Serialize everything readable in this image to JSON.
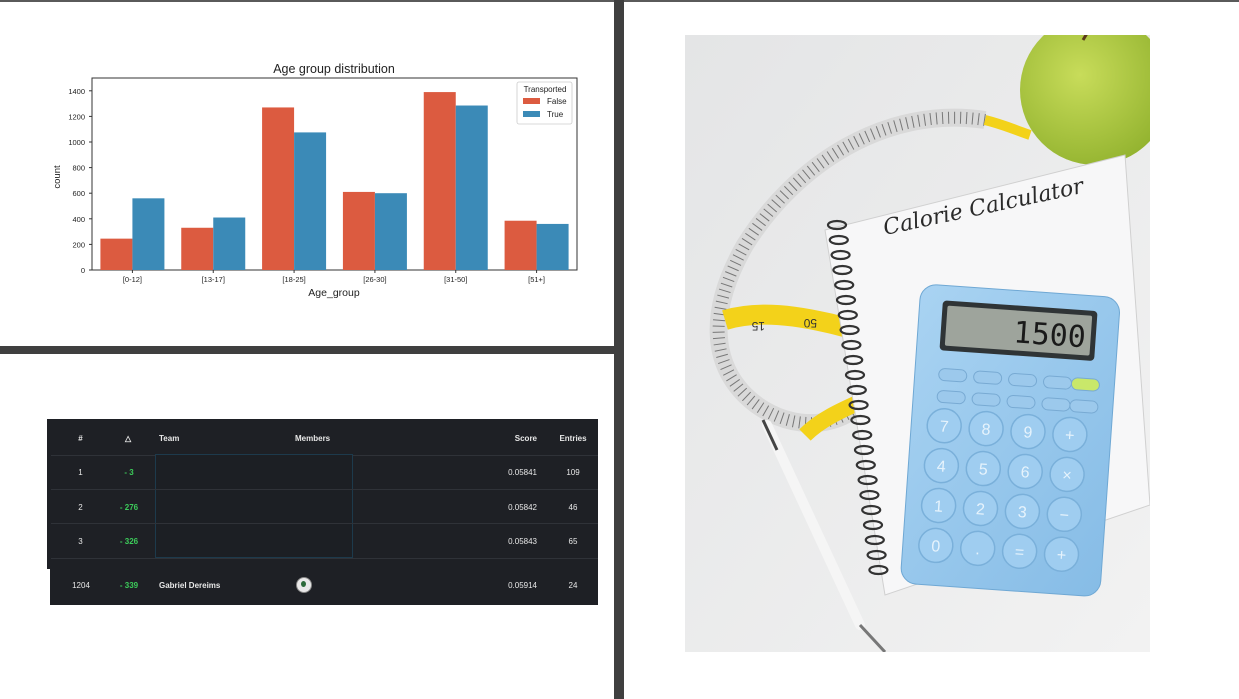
{
  "chart_data": {
    "type": "bar",
    "title": "Age group distribution",
    "xlabel": "Age_group",
    "ylabel": "count",
    "categories": [
      "[0-12]",
      "[13-17]",
      "[18-25]",
      "[26-30]",
      "[31-50]",
      "[51+]"
    ],
    "series": [
      {
        "name": "False",
        "color": "#dc5b40",
        "values": [
          245,
          330,
          1270,
          610,
          1390,
          385
        ]
      },
      {
        "name": "True",
        "color": "#3b8ab7",
        "values": [
          560,
          410,
          1075,
          600,
          1285,
          360
        ]
      }
    ],
    "legend_title": "Transported",
    "legend_position": "top-right",
    "ylim": [
      0,
      1500
    ],
    "yticks": [
      0,
      200,
      400,
      600,
      800,
      1000,
      1200,
      1400
    ],
    "grid": false
  },
  "leaderboard": {
    "headers": {
      "rank": "#",
      "delta": "△",
      "team": "Team",
      "members": "Members",
      "score": "Score",
      "entries": "Entries"
    },
    "rows": [
      {
        "rank": "1",
        "delta": "- 3",
        "score": "0.05841",
        "entries": "109"
      },
      {
        "rank": "2",
        "delta": "- 276",
        "score": "0.05842",
        "entries": "46"
      },
      {
        "rank": "3",
        "delta": "- 326",
        "score": "0.05843",
        "entries": "65"
      }
    ],
    "user_row": {
      "rank": "1204",
      "delta": "- 339",
      "team": "Gabriel Dereims",
      "score": "0.05914",
      "entries": "24"
    }
  },
  "photo": {
    "notebook_text": "Calorie Calculator",
    "display_value": "1500",
    "tape_marks": [
      "15",
      "50"
    ],
    "keys": [
      "7",
      "8",
      "9",
      "+",
      "4",
      "5",
      "6",
      "×",
      "1",
      "2",
      "3",
      "−",
      "0",
      ".",
      "=",
      "+"
    ]
  }
}
